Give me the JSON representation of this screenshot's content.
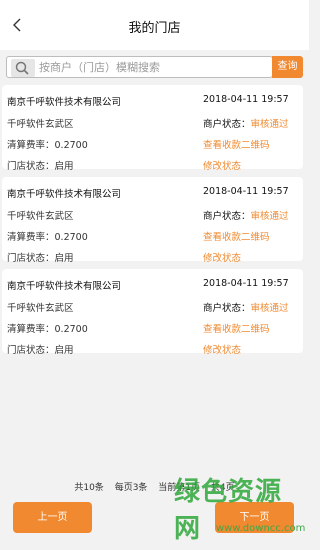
{
  "header": {
    "title": "我的门店"
  },
  "search": {
    "placeholder": "按商户（门店）模糊搜索",
    "button_label": "查询"
  },
  "stores": [
    {
      "name": "南京千呼软件技术有限公司",
      "date": "2018-04-11 19:57",
      "district": "千呼软件玄武区",
      "merchant_status_label": "商户状态：",
      "merchant_status_value": "审核通过",
      "fee": "清算费率：0.2700",
      "qr_link": "查看收款二维码",
      "store_status": "门店状态：启用",
      "modify_link": "修改状态"
    },
    {
      "name": "南京千呼软件技术有限公司",
      "date": "2018-04-11 19:57",
      "district": "千呼软件玄武区",
      "merchant_status_label": "商户状态：",
      "merchant_status_value": "审核通过",
      "fee": "清算费率：0.2700",
      "qr_link": "查看收款二维码",
      "store_status": "门店状态：启用",
      "modify_link": "修改状态"
    },
    {
      "name": "南京千呼软件技术有限公司",
      "date": "2018-04-11 19:57",
      "district": "千呼软件玄武区",
      "merchant_status_label": "商户状态：",
      "merchant_status_value": "审核通过",
      "fee": "清算费率：0.2700",
      "qr_link": "查看收款二维码",
      "store_status": "门店状态：启用",
      "modify_link": "修改状态"
    }
  ],
  "pagination": {
    "total": "共10条",
    "per_page": "每页3条",
    "current": "当前第1页",
    "pages": "共4页"
  },
  "buttons": {
    "prev": "上一页",
    "next": "下一页"
  },
  "watermark": {
    "text": "绿色资源网",
    "url": "www.downcc.com"
  },
  "colors": {
    "accent": "#f0892f",
    "background": "#f2f2f2",
    "watermark": "#2fa83a"
  },
  "icons": {
    "back": "chevron-left-icon",
    "search": "search-icon"
  }
}
